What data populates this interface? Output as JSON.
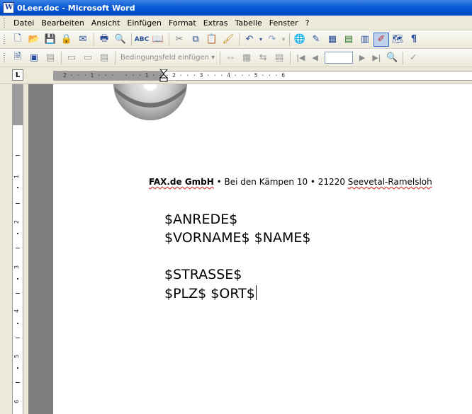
{
  "window": {
    "title": "0Leer.doc - Microsoft Word"
  },
  "menu": {
    "items": [
      "Datei",
      "Bearbeiten",
      "Ansicht",
      "Einfügen",
      "Format",
      "Extras",
      "Tabelle",
      "Fenster",
      "?"
    ]
  },
  "toolbar": {
    "standard_icons": [
      "new-doc-icon",
      "open-icon",
      "save-icon",
      "permission-icon",
      "email-icon",
      "print-icon",
      "print-preview-icon",
      "spelling-icon",
      "research-icon",
      "cut-icon",
      "copy-icon",
      "paste-icon",
      "format-painter-icon",
      "undo-icon",
      "redo-icon",
      "hyperlink-icon",
      "tables-borders-icon",
      "insert-table-icon",
      "insert-excel-icon",
      "columns-icon",
      "drawing-icon",
      "document-map-icon",
      "show-formatting-icon"
    ]
  },
  "mailmerge": {
    "insert_field_label": "Bedingungsfeld einfügen ▾"
  },
  "ruler": {
    "tab_selector": "L",
    "h_numbers": "2 · · · 1 · · ·   · · · 1 · · · 2 · · · 3 · · · 4 · · · 5 · · · 6",
    "v_numbers": [
      "1",
      "2",
      "3",
      "4",
      "5",
      "6"
    ]
  },
  "document": {
    "sender_company": "FAX.de GmbH",
    "sender_rest": " • Bei den Kämpen 10 • 21220 ",
    "sender_city": "Seevetal-Ramelsloh",
    "lines": [
      "$ANREDE$",
      "$VORNAME$ $NAME$",
      "",
      "$STRASSE$",
      "$PLZ$ $ORT$"
    ]
  }
}
